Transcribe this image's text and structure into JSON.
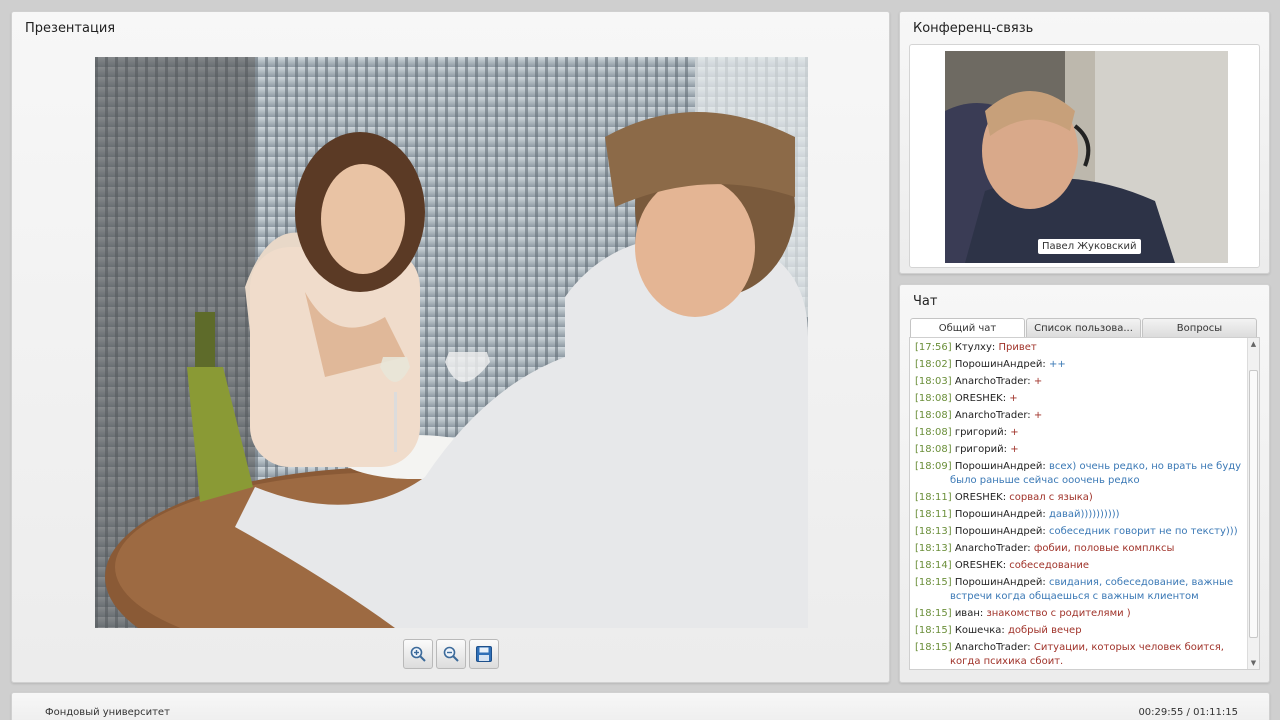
{
  "presentation": {
    "title": "Презентация",
    "toolbar": {
      "zoom_in_icon": "zoom-in-icon",
      "zoom_out_icon": "zoom-out-icon",
      "save_icon": "save-icon"
    }
  },
  "conference": {
    "title": "Конференц-связь",
    "speaker_name": "Павел Жуковский"
  },
  "chat": {
    "title": "Чат",
    "tabs": [
      {
        "label": "Общий чат",
        "active": true
      },
      {
        "label": "Список пользова...",
        "active": false
      },
      {
        "label": "Вопросы",
        "active": false
      }
    ],
    "messages": [
      {
        "time": "[17:56]",
        "author": "Ктулху:",
        "text": "Привет",
        "color": "#a0332a"
      },
      {
        "time": "[18:02]",
        "author": "ПорошинАндрей:",
        "text": "++",
        "color": "#3a78b5"
      },
      {
        "time": "[18:03]",
        "author": "AnarchoTrader:",
        "text": "+",
        "color": "#a0332a"
      },
      {
        "time": "[18:08]",
        "author": "ORESHEK:",
        "text": "+",
        "color": "#a0332a"
      },
      {
        "time": "[18:08]",
        "author": "AnarchoTrader:",
        "text": "+",
        "color": "#a0332a"
      },
      {
        "time": "[18:08]",
        "author": "григорий:",
        "text": "+",
        "color": "#a0332a"
      },
      {
        "time": "[18:08]",
        "author": "григорий:",
        "text": "+",
        "color": "#a0332a"
      },
      {
        "time": "[18:09]",
        "author": "ПорошинАндрей:",
        "text": "всех) очень редко, но врать не буду было раньше сейчас ооочень редко",
        "color": "#3a78b5"
      },
      {
        "time": "[18:11]",
        "author": "ORESHEK:",
        "text": "сорвал с языка)",
        "color": "#a0332a"
      },
      {
        "time": "[18:11]",
        "author": "ПорошинАндрей:",
        "text": "давай))))))))))",
        "color": "#3a78b5"
      },
      {
        "time": "[18:13]",
        "author": "ПорошинАндрей:",
        "text": "собеседник говорит не по тексту)))",
        "color": "#3a78b5"
      },
      {
        "time": "[18:13]",
        "author": "AnarchoTrader:",
        "text": "фобии, половые комплксы",
        "color": "#a0332a"
      },
      {
        "time": "[18:14]",
        "author": "ORESHEK:",
        "text": "собеседование",
        "color": "#a0332a"
      },
      {
        "time": "[18:15]",
        "author": "ПорошинАндрей:",
        "text": "свидания, собеседование, важные встречи когда общаешься с важным клиентом",
        "color": "#3a78b5"
      },
      {
        "time": "[18:15]",
        "author": "иван:",
        "text": "знакомство с родителями )",
        "color": "#a0332a"
      },
      {
        "time": "[18:15]",
        "author": "Кошечка:",
        "text": "добрый вечер",
        "color": "#a0332a"
      },
      {
        "time": "[18:15]",
        "author": "AnarchoTrader:",
        "text": "Ситуации, которых человек боится, когда психика сбоит.",
        "color": "#a0332a"
      }
    ]
  },
  "footer": {
    "title": "Фондовый университет",
    "time": "00:29:55 / 01:11:15"
  }
}
